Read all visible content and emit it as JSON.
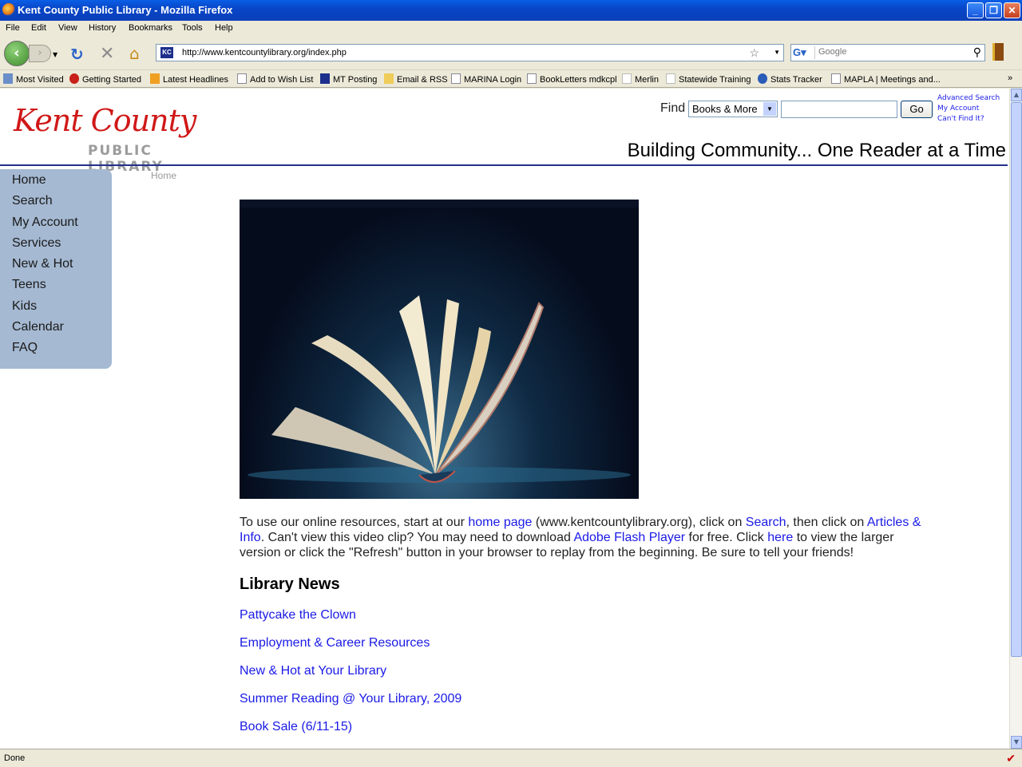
{
  "window": {
    "title": "Kent County Public Library - Mozilla Firefox"
  },
  "menu": [
    "File",
    "Edit",
    "View",
    "History",
    "Bookmarks",
    "Tools",
    "Help"
  ],
  "toolbar": {
    "url": "http://www.kentcountylibrary.org/index.php",
    "search_placeholder": "Google"
  },
  "bookmarks": [
    "Most Visited",
    "Getting Started",
    "Latest Headlines",
    "Add to Wish List",
    "MT Posting",
    "Email & RSS",
    "MARINA Login",
    "BookLetters mdkcpl",
    "Merlin",
    "Statewide Training",
    "Stats Tracker",
    "MAPLA | Meetings and..."
  ],
  "header": {
    "logo_script": "Kent County",
    "logo_plain": "PUBLIC LIBRARY",
    "find_label": "Find",
    "find_selected": "Books & More",
    "go_label": "Go",
    "links": [
      "Advanced Search",
      "My Account",
      "Can't Find It?"
    ],
    "tagline": "Building Community... One Reader at a Time"
  },
  "sidenav": [
    "Home",
    "Search",
    "My Account",
    "Services",
    "New & Hot",
    "Teens",
    "Kids",
    "Calendar",
    "FAQ"
  ],
  "breadcrumb": "Home",
  "intro": {
    "t1": "To use our online resources, start at our ",
    "l1": "home page",
    "t2": " (www.kentcountylibrary.org), click on ",
    "l2": "Search",
    "t3": ", then click on ",
    "l3": "Articles & Info",
    "t4": ". Can't view this video clip? You may need to download ",
    "l4": "Adobe Flash Player",
    "t5": " for free. Click ",
    "l5": "here",
    "t6": " to view the larger version or click the \"Refresh\" button in your browser to replay from the beginning. Be sure to tell your friends!"
  },
  "news": {
    "title": "Library News",
    "items": [
      "Pattycake the Clown",
      "Employment & Career Resources",
      "New & Hot at Your Library",
      "Summer Reading @ Your Library, 2009",
      "Book Sale (6/11-15)"
    ]
  },
  "status": {
    "text": "Done"
  }
}
